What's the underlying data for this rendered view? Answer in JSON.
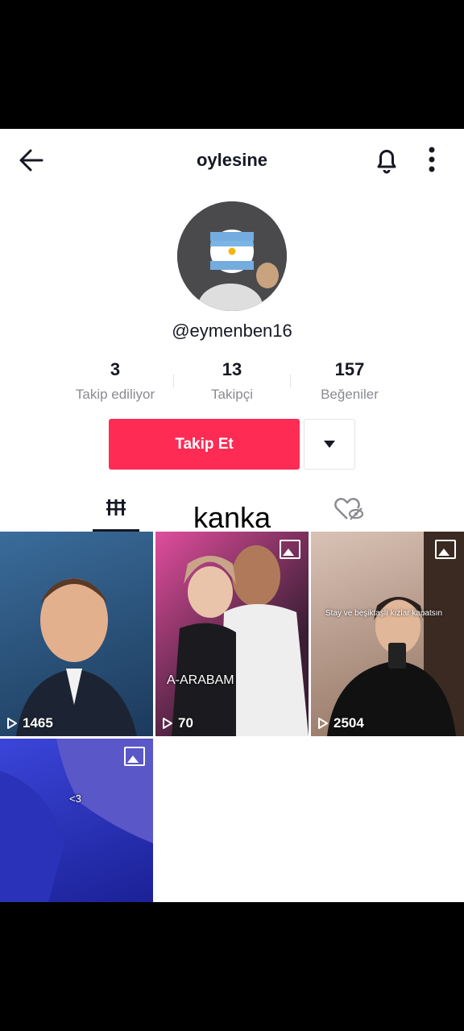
{
  "header": {
    "title": "oylesine"
  },
  "profile": {
    "handle": "@eymenben16",
    "stats": [
      {
        "value": "3",
        "label": "Takip ediliyor"
      },
      {
        "value": "13",
        "label": "Takipçi"
      },
      {
        "value": "157",
        "label": "Beğeniler"
      }
    ],
    "follow_label": "Takip Et"
  },
  "caption": "kanka",
  "videos": [
    {
      "views": "1465",
      "overlay": ""
    },
    {
      "views": "70",
      "overlay": "A-ARABAM"
    },
    {
      "views": "2504",
      "overlay": "Stay ve beşiktaşlı kızlar kapatsın"
    },
    {
      "views": "",
      "overlay": "<3"
    }
  ],
  "colors": {
    "accent": "#fe2c55",
    "text": "#161823",
    "muted": "#8a8b91"
  },
  "icons": [
    "back-arrow-icon",
    "bell-icon",
    "more-icon",
    "grid-icon",
    "liked-icon",
    "play-icon",
    "photo-icon"
  ]
}
